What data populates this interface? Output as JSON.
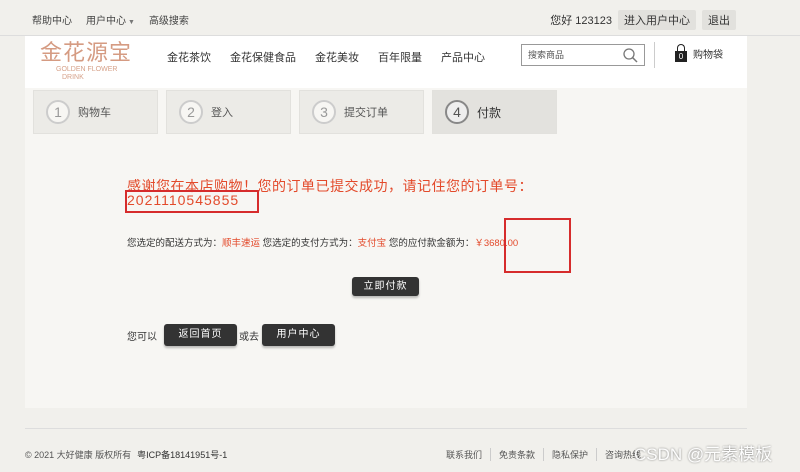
{
  "topbar": {
    "left_links": [
      "帮助中心",
      "用户中心",
      "高级搜索"
    ],
    "greeting": "您好 123123",
    "user_center_label": "进入用户中心",
    "logout_label": "退出"
  },
  "header": {
    "logo_cn": "金花源宝",
    "logo_en_1": "GOLDEN FLOWER",
    "logo_en_2": "DRINK",
    "nav": [
      "金花茶饮",
      "金花保健食品",
      "金花美妆",
      "百年限量",
      "产品中心"
    ],
    "search_placeholder": "搜索商品",
    "cart_count": "0",
    "cart_label": "购物袋"
  },
  "steps": [
    {
      "num": "1",
      "label": "购物车"
    },
    {
      "num": "2",
      "label": "登入"
    },
    {
      "num": "3",
      "label": "提交订单"
    },
    {
      "num": "4",
      "label": "付款"
    }
  ],
  "order": {
    "thanks_text": "感谢您在本店购物！您的订单已提交成功，请记住您的订单号：",
    "order_number": "2021110545855",
    "shipping_prefix": "您选定的配送方式为：",
    "shipping_method": "顺丰速运",
    "payment_prefix": " 您选定的支付方式为：",
    "payment_method": "支付宝",
    "amount_prefix": " 您的应付款金额为：",
    "amount": "￥3680.00",
    "pay_button": "立即付款",
    "return_prefix": "您可以",
    "home_button": "返回首页",
    "or_text": "或去",
    "user_button": "用户中心"
  },
  "footer": {
    "copyright": "© 2021 大好健康 版权所有",
    "icp": "粤ICP备18141951号-1",
    "links": [
      "联系我们",
      "免责条款",
      "隐私保护",
      "咨询热线"
    ],
    "watermark": "CSDN @元素模板"
  },
  "colors": {
    "accent_red": "#e34a2b",
    "highlight_box": "#d62c2c",
    "button_dark": "#333333"
  }
}
